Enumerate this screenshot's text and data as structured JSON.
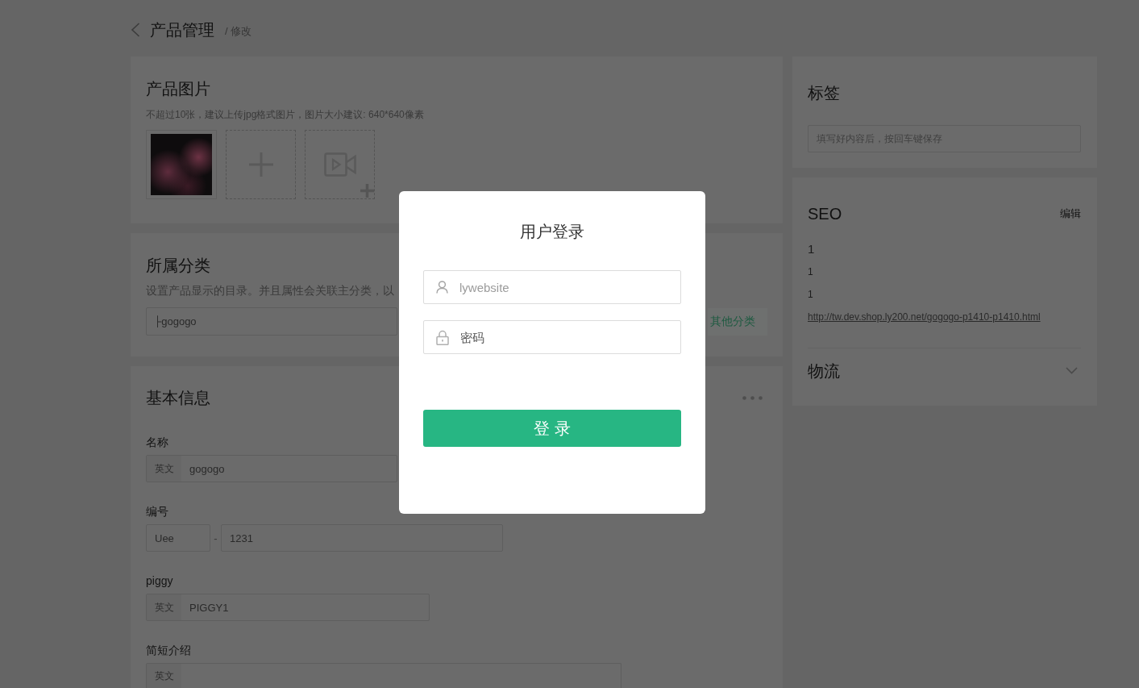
{
  "header": {
    "title": "产品管理",
    "subtitle": "/ 修改"
  },
  "images_card": {
    "title": "产品图片",
    "hint": "不超过10张，建议上传jpg格式图片，图片大小建议: 640*640像素",
    "media": [
      {
        "kind": "photo"
      },
      {
        "kind": "add_image"
      },
      {
        "kind": "add_video"
      }
    ]
  },
  "category_card": {
    "title": "所属分类",
    "hint": "设置产品显示的目录。并且属性会关联主分类，以",
    "value": "├gogogo",
    "add_button": "其他分类"
  },
  "basic_info": {
    "title": "基本信息",
    "fields": [
      {
        "kind": "localized",
        "label": "名称",
        "prefix": "英文",
        "value": "gogogo"
      },
      {
        "kind": "code",
        "label": "编号",
        "prefix_value": "Uee",
        "separator": "-",
        "value": "1231"
      },
      {
        "kind": "localized",
        "label": "piggy",
        "prefix": "英文",
        "value": "PIGGY1"
      },
      {
        "kind": "localized",
        "label": "简短介绍",
        "prefix": "英文"
      }
    ]
  },
  "tags_card": {
    "title": "标签",
    "placeholder": "填写好内容后，按回车键保存"
  },
  "seo_card": {
    "title": "SEO",
    "edit": "编辑",
    "lines": [
      "1",
      "1",
      "1"
    ],
    "url": "http://tw.dev.shop.ly200.net/gogogo-p1410-p1410.html"
  },
  "logistics": {
    "title": "物流",
    "expanded": false
  },
  "login_dialog": {
    "title": "用户登录",
    "username": {
      "value": "lywebsite"
    },
    "password": {
      "placeholder": "密码"
    },
    "submit": "登 录"
  }
}
